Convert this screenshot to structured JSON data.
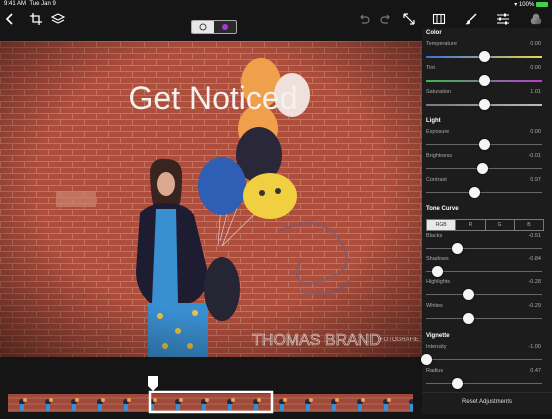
{
  "status": {
    "time": "9:41 AM",
    "date": "Tue Jan 9",
    "battery": "100%"
  },
  "photo": {
    "headline": "Get Noticed",
    "watermark_main": "THOMAS BRAND",
    "watermark_sub": "FOTOGRAFIE"
  },
  "panel": {
    "color": {
      "title": "Color",
      "sliders": [
        {
          "label": "Temperature",
          "value": "0.00",
          "level": 0.5
        },
        {
          "label": "Tint",
          "value": "0.00",
          "level": 0.5
        },
        {
          "label": "Saturation",
          "value": "1.01",
          "level": 0.5
        }
      ]
    },
    "light": {
      "title": "Light",
      "sliders": [
        {
          "label": "Exposure",
          "value": "0.00",
          "level": 0.5
        },
        {
          "label": "Brightness",
          "value": "-0.01",
          "level": 0.49
        },
        {
          "label": "Contrast",
          "value": "0.97",
          "level": 0.42
        }
      ]
    },
    "tone_curve": {
      "title": "Tone Curve",
      "channels": [
        "RGB",
        "R",
        "G",
        "B"
      ],
      "selected": "RGB",
      "sliders": [
        {
          "label": "Blacks",
          "value": "-0.51",
          "level": 0.27
        },
        {
          "label": "Shadows",
          "value": "-0.84",
          "level": 0.1
        },
        {
          "label": "Highlights",
          "value": "-0.28",
          "level": 0.37
        },
        {
          "label": "Whites",
          "value": "-0.29",
          "level": 0.37
        }
      ]
    },
    "vignette": {
      "title": "Vignette",
      "sliders": [
        {
          "label": "Intensity",
          "value": "-1.00",
          "level": 0.0
        },
        {
          "label": "Radius",
          "value": "0.47",
          "level": 0.27
        }
      ]
    },
    "reset_label": "Reset Adjustments"
  },
  "icons": [
    "back-icon",
    "crop-icon",
    "layers-icon",
    "undo-icon",
    "redo-icon",
    "expand-icon",
    "filmstrip-icon",
    "brush-icon",
    "sliders-icon",
    "color-circles-icon"
  ]
}
